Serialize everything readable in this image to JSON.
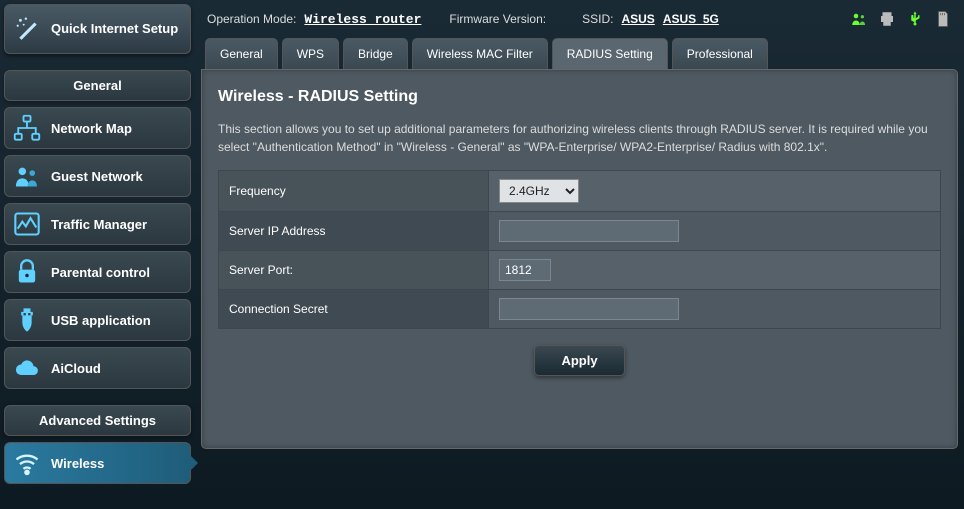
{
  "qis_label": "Quick Internet Setup",
  "sections": {
    "general": {
      "header": "General",
      "items": [
        {
          "label": "Network Map",
          "icon": "network-map-icon"
        },
        {
          "label": "Guest Network",
          "icon": "guest-network-icon"
        },
        {
          "label": "Traffic Manager",
          "icon": "traffic-manager-icon"
        },
        {
          "label": "Parental control",
          "icon": "parental-control-icon"
        },
        {
          "label": "USB application",
          "icon": "usb-app-icon"
        },
        {
          "label": "AiCloud",
          "icon": "aicloud-icon"
        }
      ]
    },
    "advanced": {
      "header": "Advanced Settings",
      "items": [
        {
          "label": "Wireless",
          "icon": "wireless-icon",
          "active": true
        }
      ]
    }
  },
  "status": {
    "op_mode_label": "Operation Mode:",
    "op_mode_value": "Wireless router",
    "fw_label": "Firmware Version:",
    "ssid_label": "SSID:",
    "ssid_1": "ASUS",
    "ssid_2": "ASUS_5G"
  },
  "tabs": [
    "General",
    "WPS",
    "Bridge",
    "Wireless MAC Filter",
    "RADIUS Setting",
    "Professional"
  ],
  "active_tab": "RADIUS Setting",
  "page": {
    "title": "Wireless - RADIUS Setting",
    "description": "This section allows you to set up additional parameters for authorizing wireless clients through RADIUS server. It is required while you select \"Authentication Method\" in \"Wireless - General\" as \"WPA-Enterprise/ WPA2-Enterprise/ Radius with 802.1x\".",
    "fields": {
      "frequency": {
        "label": "Frequency",
        "value": "2.4GHz"
      },
      "server_ip": {
        "label": "Server IP Address",
        "value": ""
      },
      "server_port": {
        "label": "Server Port:",
        "value": "1812"
      },
      "conn_secret": {
        "label": "Connection Secret",
        "value": ""
      }
    },
    "apply_label": "Apply"
  },
  "status_icons": [
    "users-icon",
    "printer-icon",
    "usb-icon",
    "sdcard-icon"
  ],
  "colors": {
    "accent": "#00ccff",
    "usb_green": "#66ff33"
  }
}
